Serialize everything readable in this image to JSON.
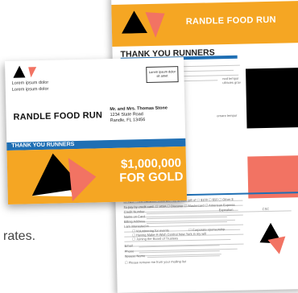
{
  "letter": {
    "header_title": "RANDLE FOOD RUN",
    "thank_you_heading": "THANK YOU RUNNERS",
    "body_snippet_1": "ned tempor",
    "body_snippet_2": "ultricies grav",
    "body_snippet_3": "ornare tempor",
    "form": {
      "pledge_line": "YES - I will transform lives with my annual gift of",
      "amounts": [
        "$100",
        "$50",
        "Other $"
      ],
      "pay_by": "To pay by credit card:",
      "cards": [
        "VISA",
        "Discover",
        "Mastercard",
        "American Express"
      ],
      "credit_number_label": "Credit Number",
      "expiration_label": "Expiration",
      "csc_label": "CSC",
      "name_on_card_label": "Name on Card",
      "billing_address_label": "Billing Address",
      "interested_label": "I am interested in",
      "interest_options": [
        "Volunteering for events",
        "Corporate sponsorship",
        "Having Make-A-Wish Central New York in my will",
        "Joining the Board of Trustees"
      ],
      "email_label": "Email",
      "phone_label": "Phone",
      "spouse_name_label": "Spouse Name",
      "remove_label": "Please remove me from your mailing list"
    }
  },
  "envelope": {
    "return_lines": [
      "Lorem ipsum dolor",
      "Lorem ipsum dolor"
    ],
    "stamp_text": "Lorem ipsum dolor sit amet",
    "brand": "RANDLE FOOD RUN",
    "recipient_name": "Mr. and Mrs. Thomas Stone",
    "recipient_street": "1234 State Road",
    "recipient_city": "Randle, FL 13456",
    "strip_label": "THANK YOU RUNNERS",
    "amount_line1": "$1,000,000",
    "amount_line2": "FOR GOLD"
  },
  "outside_text": "rates.",
  "colors": {
    "orange": "#f5a623",
    "blue": "#1f6fb4",
    "coral": "#f27363",
    "black": "#000000"
  }
}
